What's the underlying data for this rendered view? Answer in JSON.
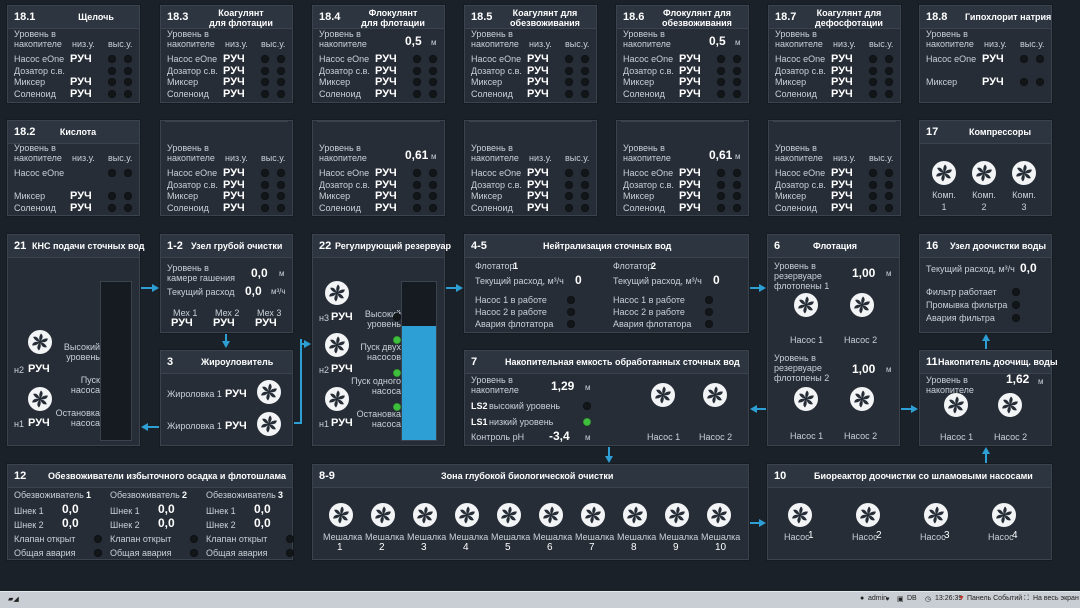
{
  "colors": {
    "accent": "#2d9fd4",
    "on": "#3ec03e",
    "panel": "#262d36",
    "bg": "#1b2129"
  },
  "mode": "РУЧ",
  "top": [
    {
      "num": "18.1",
      "name": "Щелочь",
      "level": "Уровень в\nнакопителе",
      "levels": [
        "низ.у.",
        "выс.у."
      ],
      "rows": [
        "Насос eOne",
        "Дозатор с.в.",
        "Миксер",
        "Соленоид"
      ],
      "vals": [
        "РУЧ",
        "",
        "РУЧ",
        "РУЧ"
      ]
    },
    {
      "num": "18.3",
      "name": "Коагулянт\nдля флотации",
      "level": "Уровень в\nнакопителе",
      "levels": [
        "низ.у.",
        "выс.у."
      ],
      "rows": [
        "Насос eOne",
        "Дозатор с.в.",
        "Миксер",
        "Соленоид"
      ],
      "vals": [
        "РУЧ",
        "РУЧ",
        "РУЧ",
        "РУЧ"
      ]
    },
    {
      "num": "18.4",
      "name": "Флокулянт\nдля флотации",
      "level": "Уровень в\nнакопителе",
      "levelval": "0,5",
      "levelunit": "м",
      "rows": [
        "Насос eOne",
        "Дозатор с.в.",
        "Миксер",
        "Соленоид"
      ],
      "vals": [
        "РУЧ",
        "РУЧ",
        "РУЧ",
        "РУЧ"
      ]
    },
    {
      "num": "18.5",
      "name": "Коагулянт для\nобезвоживания",
      "level": "Уровень в\nнакопителе",
      "levels": [
        "низ.у.",
        "выс.у."
      ],
      "rows": [
        "Насос eOne",
        "Дозатор с.в.",
        "Миксер",
        "Соленоид"
      ],
      "vals": [
        "РУЧ",
        "РУЧ",
        "РУЧ",
        "РУЧ"
      ]
    },
    {
      "num": "18.6",
      "name": "Флокулянт для\nобезвоживания",
      "level": "Уровень в\nнакопителе",
      "levelval": "0,5",
      "levelunit": "м",
      "rows": [
        "Насос eOne",
        "Дозатор с.в.",
        "Миксер",
        "Соленоид"
      ],
      "vals": [
        "РУЧ",
        "РУЧ",
        "РУЧ",
        "РУЧ"
      ]
    },
    {
      "num": "18.7",
      "name": "Коагулянт для\nдефосфотации",
      "level": "Уровень в\nнакопителе",
      "levels": [
        "низ.у.",
        "выс.у."
      ],
      "rows": [
        "Насос eOne",
        "Дозатор с.в.",
        "Миксер",
        "Соленоид"
      ],
      "vals": [
        "РУЧ",
        "РУЧ",
        "РУЧ",
        "РУЧ"
      ]
    },
    {
      "num": "18.8",
      "name": "Гипохлорит натрия",
      "level": "Уровень в\nнакопителе",
      "levels": [
        "низ.у.",
        "выс.у."
      ],
      "rows": [
        "Насос eOne",
        "",
        "Миксер"
      ],
      "vals": [
        "РУЧ",
        "",
        "РУЧ"
      ]
    }
  ],
  "second": [
    {
      "num": "18.2",
      "name": "Кислота",
      "level": "Уровень в\nнакопителе",
      "levels": [
        "низ.у.",
        "выс.у."
      ],
      "rows": [
        "Насос eOne",
        "",
        "Миксер",
        "Соленоид"
      ],
      "vals": [
        "",
        "",
        "РУЧ",
        "РУЧ"
      ]
    },
    {
      "level": "Уровень в\nнакопителе",
      "levels": [
        "низ.у.",
        "выс.у."
      ],
      "rows": [
        "Насос eOne",
        "Дозатор с.в.",
        "Миксер",
        "Соленоид"
      ],
      "vals": [
        "РУЧ",
        "РУЧ",
        "РУЧ",
        "РУЧ"
      ]
    },
    {
      "level": "Уровень в\nнакопителе",
      "levelval": "0,61",
      "levelunit": "м",
      "rows": [
        "Насос eOne",
        "Дозатор с.в.",
        "Миксер",
        "Соленоид"
      ],
      "vals": [
        "РУЧ",
        "РУЧ",
        "РУЧ",
        "РУЧ"
      ]
    },
    {
      "level": "Уровень в\nнакопителе",
      "levels": [
        "низ.у.",
        "выс.у."
      ],
      "rows": [
        "Насос eOne",
        "Дозатор с.в.",
        "Миксер",
        "Соленоид"
      ],
      "vals": [
        "РУЧ",
        "РУЧ",
        "РУЧ",
        "РУЧ"
      ]
    },
    {
      "level": "Уровень в\nнакопителе",
      "levelval": "0,61",
      "levelunit": "м",
      "rows": [
        "Насос eOne",
        "Дозатор с.в.",
        "Миксер",
        "Соленоид"
      ],
      "vals": [
        "РУЧ",
        "РУЧ",
        "РУЧ",
        "РУЧ"
      ]
    },
    {
      "level": "Уровень в\nнакопителе",
      "levels": [
        "низ.у.",
        "выс.у."
      ],
      "rows": [
        "Насос eOne",
        "Дозатор с.в.",
        "Миксер",
        "Соленоид"
      ],
      "vals": [
        "РУЧ",
        "РУЧ",
        "РУЧ",
        "РУЧ"
      ]
    }
  ],
  "compressors": {
    "num": "17",
    "name": "Компрессоры",
    "items": [
      "Комп.\n1",
      "Комп.\n2",
      "Комп.\n3"
    ]
  },
  "kns": {
    "num": "21",
    "name": "КНС подачи сточных вод",
    "labels": [
      "Высокий\nуровень",
      "Пуск\nнасоса",
      "Остановка\nнасоса"
    ],
    "pumps": [
      "н2",
      "н1"
    ],
    "vals": [
      "РУЧ",
      "РУЧ"
    ]
  },
  "coarse": {
    "num": "1-2",
    "name": "Узел грубой очистки",
    "l1": "Уровень в\nкамере гашения",
    "v1": "0,0",
    "u1": "м",
    "l2": "Текущий расход",
    "v2": "0,0",
    "u2": "м³/ч",
    "mex": [
      "Мех 1",
      "Мех 2",
      "Мех 3"
    ],
    "mexvals": [
      "РУЧ",
      "РУЧ",
      "РУЧ"
    ]
  },
  "grease": {
    "num": "3",
    "name": "Жироуловитель",
    "rows": [
      "Жироловка 1",
      "Жироловка 1"
    ],
    "vals": [
      "РУЧ",
      "РУЧ"
    ]
  },
  "regtank": {
    "num": "22",
    "name": "Регулирующий резервуар",
    "labels": [
      "Высокий\nуровень",
      "Пуск двух\nнасосов",
      "Пуск одного\nнасоса",
      "Остановка\nнасоса"
    ],
    "pumps": [
      "н3",
      "н2",
      "н1"
    ],
    "vals": [
      "РУЧ",
      "РУЧ",
      "РУЧ"
    ],
    "fill": 0.72
  },
  "neutral": {
    "num": "4-5",
    "name": "Нейтрализация сточных вод",
    "f1": "Флотатор",
    "f1n": "1",
    "f2": "Флотатор",
    "f2n": "2",
    "flow": "Текущий расход, м³/ч",
    "v1": "0",
    "v2": "0",
    "rows1": [
      "Насос 1 в работе",
      "Насос 2 в работе",
      "Авария флотатора"
    ],
    "rows2": [
      "Насос 1 в работе",
      "Насос 2 в работе",
      "Авария флотатора"
    ]
  },
  "flot": {
    "num": "6",
    "name": "Флотация",
    "l1": "Уровень в\nрезервуаре\nфлотопены 1",
    "v1": "1,00",
    "l2": "Уровень в\nрезервуаре\nфлотопены 2",
    "v2": "1,00",
    "unit": "м",
    "pumps": [
      "Насос 1",
      "Насос 2"
    ]
  },
  "posttreat": {
    "num": "16",
    "name": "Узел доочистки воды",
    "flow": "Текущий расход, м³/ч",
    "fv": "0,0",
    "rows": [
      "Фильтр работает",
      "Промывка фильтра",
      "Авария фильтра"
    ]
  },
  "stor": {
    "num": "7",
    "name": "Накопительная емкость обработанных сточных вод",
    "l1": "Уровень в\nнакопителе",
    "v1": "1,29",
    "u1": "м",
    "ls2": "LS2",
    "ls2t": "высокий уровень",
    "ls1": "LS1",
    "ls1t": "низкий уровень",
    "ph": "Контроль рН",
    "phv": "-3,4",
    "phu": "м",
    "pumps": [
      "Насос 1",
      "Насос 2"
    ]
  },
  "clean": {
    "num": "11",
    "name": "Накопитель доочищ. воды",
    "l1": "Уровень в\nнакопителе",
    "v1": "1,62",
    "u1": "м",
    "pumps": [
      "Насос 1",
      "Насос 2"
    ]
  },
  "sludge": {
    "num": "12",
    "name": "Обезвоживатели избыточного осадка и флотошлама",
    "cols": [
      {
        "t": "Обезвоживатель",
        "n": "1"
      },
      {
        "t": "Обезвоживатель",
        "n": "2"
      },
      {
        "t": "Обезвоживатель",
        "n": "3"
      }
    ],
    "rows": [
      "Шнек 1",
      "Шнек 2",
      "Клапан открыт",
      "Общая авария"
    ],
    "v": "0,0"
  },
  "bio": {
    "num": "8-9",
    "name": "Зона глубокой биологической очистки",
    "label": "Мешалка",
    "nums": [
      "1",
      "2",
      "3",
      "4",
      "5",
      "6",
      "7",
      "8",
      "9",
      "10"
    ]
  },
  "bioreact": {
    "num": "10",
    "name": "Биореактор доочистки со шламовыми насосами",
    "label": "Насос",
    "nums": [
      "1",
      "2",
      "3",
      "4"
    ]
  },
  "taskbar": {
    "user": "admin",
    "db": "DB",
    "time": "13:26:39",
    "events": "Панель Событий",
    "full": "На весь экран"
  }
}
